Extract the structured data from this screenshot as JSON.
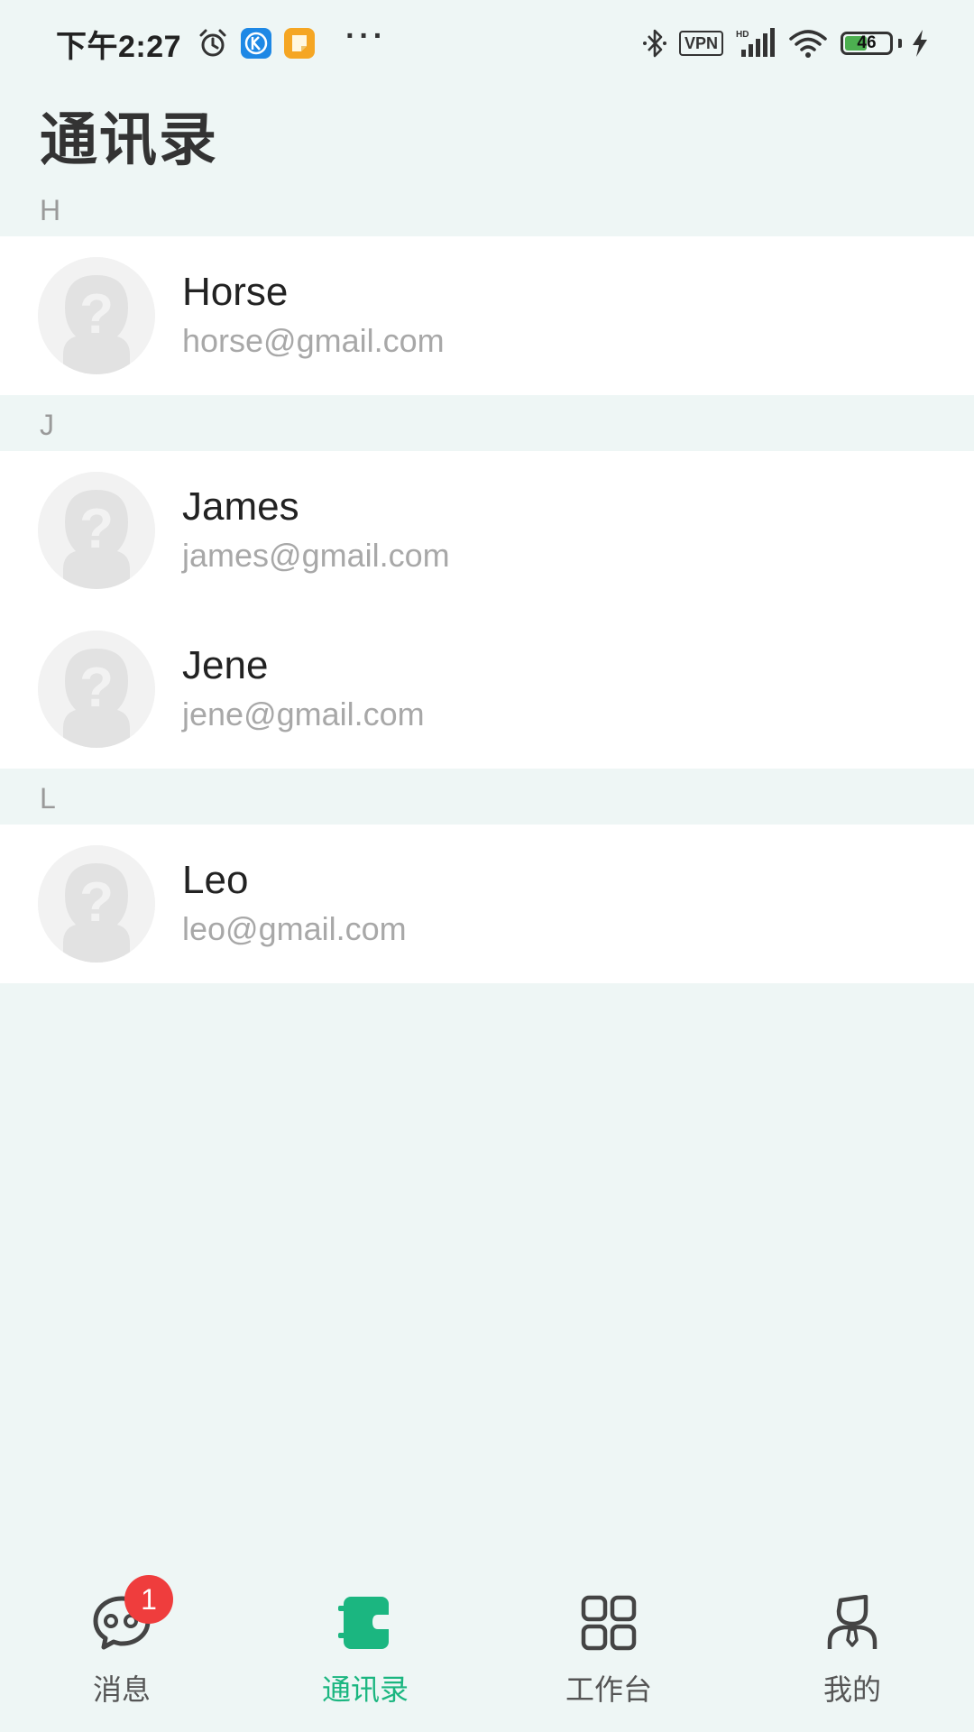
{
  "status_bar": {
    "time": "下午2:27",
    "overflow_dots": "···",
    "vpn": "VPN",
    "battery_level": "46",
    "battery_fraction": 0.46
  },
  "page": {
    "title": "通讯录"
  },
  "contacts": {
    "sections": [
      {
        "letter": "H",
        "items": [
          {
            "name": "Horse",
            "email": "horse@gmail.com"
          }
        ]
      },
      {
        "letter": "J",
        "items": [
          {
            "name": "James",
            "email": "james@gmail.com"
          },
          {
            "name": "Jene",
            "email": "jene@gmail.com"
          }
        ]
      },
      {
        "letter": "L",
        "items": [
          {
            "name": "Leo",
            "email": "leo@gmail.com"
          }
        ]
      }
    ]
  },
  "bottom_nav": {
    "items": [
      {
        "label": "消息",
        "icon": "chat-bubble-icon",
        "badge": "1"
      },
      {
        "label": "通讯录",
        "icon": "contact-book-icon",
        "active": true
      },
      {
        "label": "工作台",
        "icon": "grid-icon"
      },
      {
        "label": "我的",
        "icon": "person-icon"
      }
    ]
  },
  "colors": {
    "background": "#eef6f5",
    "accent": "#1bb680",
    "badge": "#ef3d3d"
  }
}
